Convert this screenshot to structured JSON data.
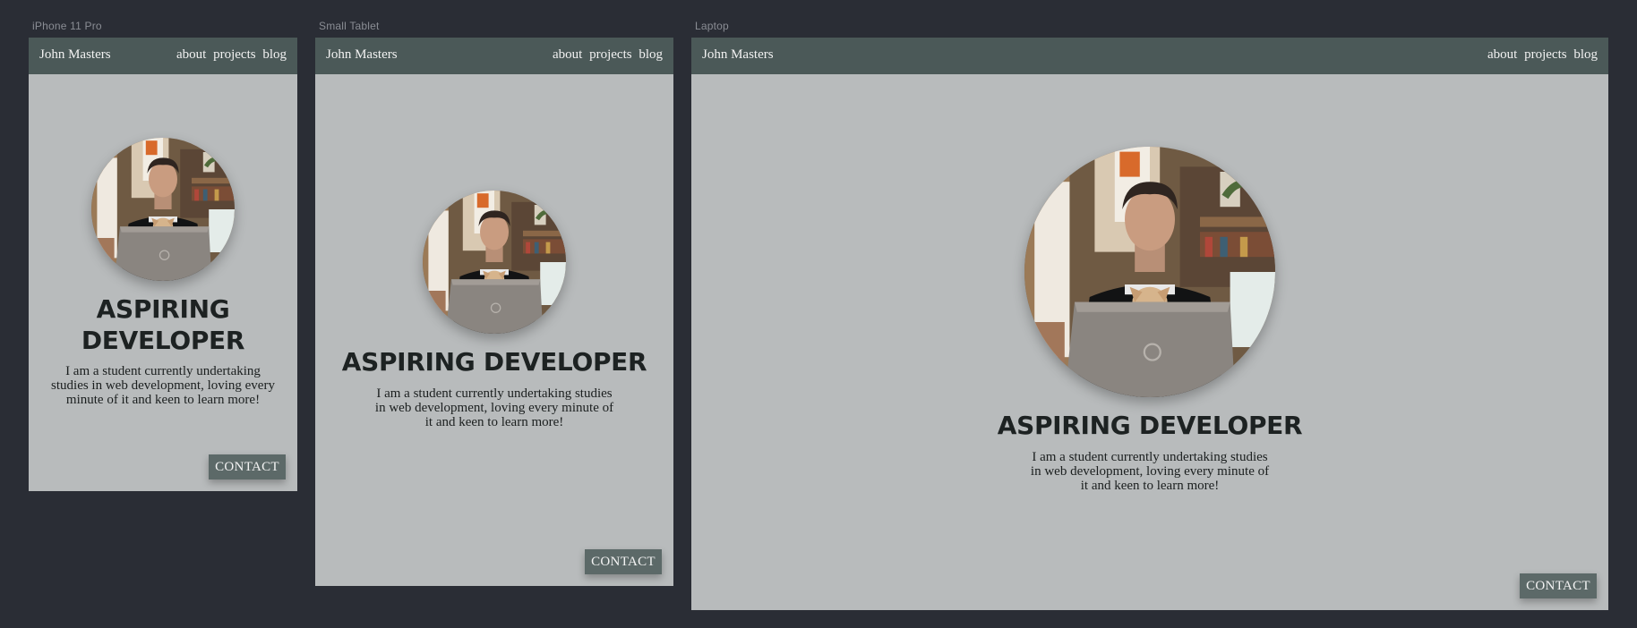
{
  "colors": {
    "canvas": "#2a2d35",
    "frame_bg": "#b8bbbc",
    "nav_bg": "#4b5958",
    "button_bg": "#5c6968",
    "headline": "#1d2222"
  },
  "frames": [
    {
      "label": "iPhone 11 Pro",
      "nav": {
        "brand": "John Masters",
        "links": [
          "about",
          "projects",
          "blog"
        ]
      },
      "avatar": "profile-photo",
      "headline_lines": [
        "ASPIRING",
        "DEVELOPER"
      ],
      "intro_lines": [
        "I am a student currently undertaking",
        "studies in web development, loving every",
        "minute of it and keen to learn more!"
      ],
      "contact_label": "CONTACT"
    },
    {
      "label": "Small Tablet",
      "nav": {
        "brand": "John Masters",
        "links": [
          "about",
          "projects",
          "blog"
        ]
      },
      "avatar": "profile-photo",
      "headline_lines": [
        "ASPIRING DEVELOPER"
      ],
      "intro_lines": [
        "I am a student currently undertaking studies",
        "in web development, loving every minute of",
        "it and keen to learn more!"
      ],
      "contact_label": "CONTACT"
    },
    {
      "label": "Laptop",
      "nav": {
        "brand": "John Masters",
        "links": [
          "about",
          "projects",
          "blog"
        ]
      },
      "avatar": "profile-photo",
      "headline_lines": [
        "ASPIRING DEVELOPER"
      ],
      "intro_lines": [
        "I am a student currently undertaking studies",
        "in web development, loving every minute of",
        "it and keen to learn more!"
      ],
      "contact_label": "CONTACT"
    }
  ]
}
